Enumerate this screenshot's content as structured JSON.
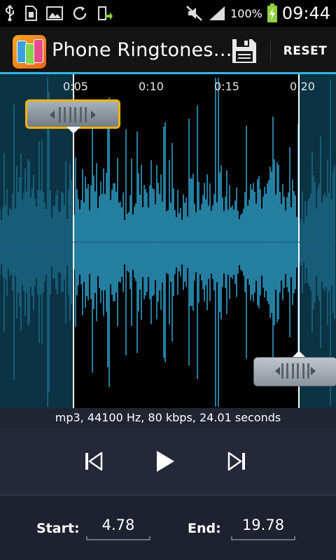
{
  "status_bar": {
    "battery_percent": "100%",
    "time": "09:44",
    "icons": [
      "usb-icon",
      "sim-storage-icon",
      "image-icon",
      "sync-icon",
      "export-icon",
      "mute-icon",
      "signal-icon",
      "battery-charging-icon"
    ]
  },
  "action_bar": {
    "app_title": "Phone Ringtones…",
    "app_icon": "phone-ringtones-app-icon",
    "save_icon": "floppy-disk-icon",
    "reset_label": "RESET"
  },
  "waveform": {
    "time_markers": [
      "0:05",
      "0:10",
      "0:15",
      "0:20"
    ],
    "selection_start_seconds": 4.78,
    "selection_end_seconds": 19.78,
    "accent_color": "#33b5e5",
    "background_color": "#0b3344",
    "selected_bg_color": "#000000"
  },
  "info": {
    "text": "mp3, 44100 Hz, 80 kbps, 24.01 seconds"
  },
  "controls": {
    "previous_icon": "skip-previous-icon",
    "play_icon": "play-icon",
    "next_icon": "skip-next-icon"
  },
  "footer": {
    "start_label": "Start:",
    "start_value": "4.78",
    "end_label": "End:",
    "end_value": "19.78"
  }
}
